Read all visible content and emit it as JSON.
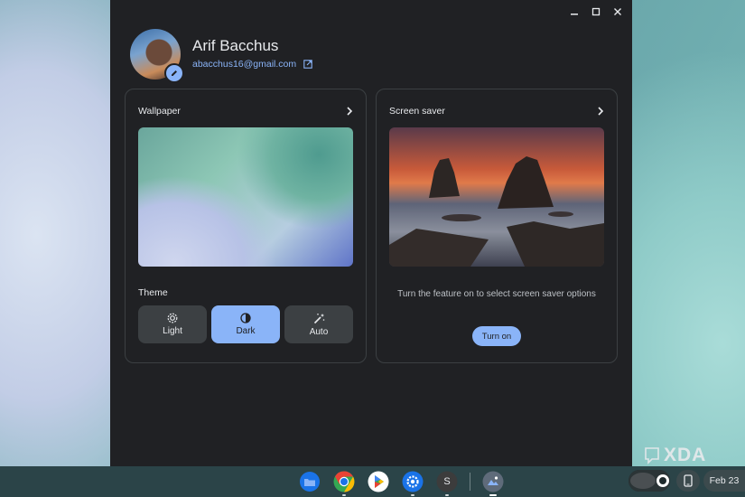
{
  "profile": {
    "name": "Arif Bacchus",
    "email": "abacchus16@gmail.com"
  },
  "wallpaper_card": {
    "title": "Wallpaper",
    "theme_label": "Theme",
    "themes": [
      {
        "label": "Light",
        "icon": "brightness-icon",
        "selected": false
      },
      {
        "label": "Dark",
        "icon": "contrast-icon",
        "selected": true
      },
      {
        "label": "Auto",
        "icon": "magic-wand-icon",
        "selected": false
      }
    ]
  },
  "screensaver_card": {
    "title": "Screen saver",
    "description": "Turn the feature on to select screen saver options",
    "button_label": "Turn on"
  },
  "shelf": {
    "apps": [
      {
        "name": "files-icon"
      },
      {
        "name": "chrome-icon"
      },
      {
        "name": "play-store-icon"
      },
      {
        "name": "settings-icon"
      },
      {
        "name": "s-app-icon",
        "letter": "S"
      },
      {
        "name": "personalization-icon"
      }
    ],
    "date": "Feb 23"
  },
  "watermark": "XDA",
  "colors": {
    "accent": "#8ab4f8",
    "window_bg": "#202124",
    "card_border": "#3c4043"
  }
}
